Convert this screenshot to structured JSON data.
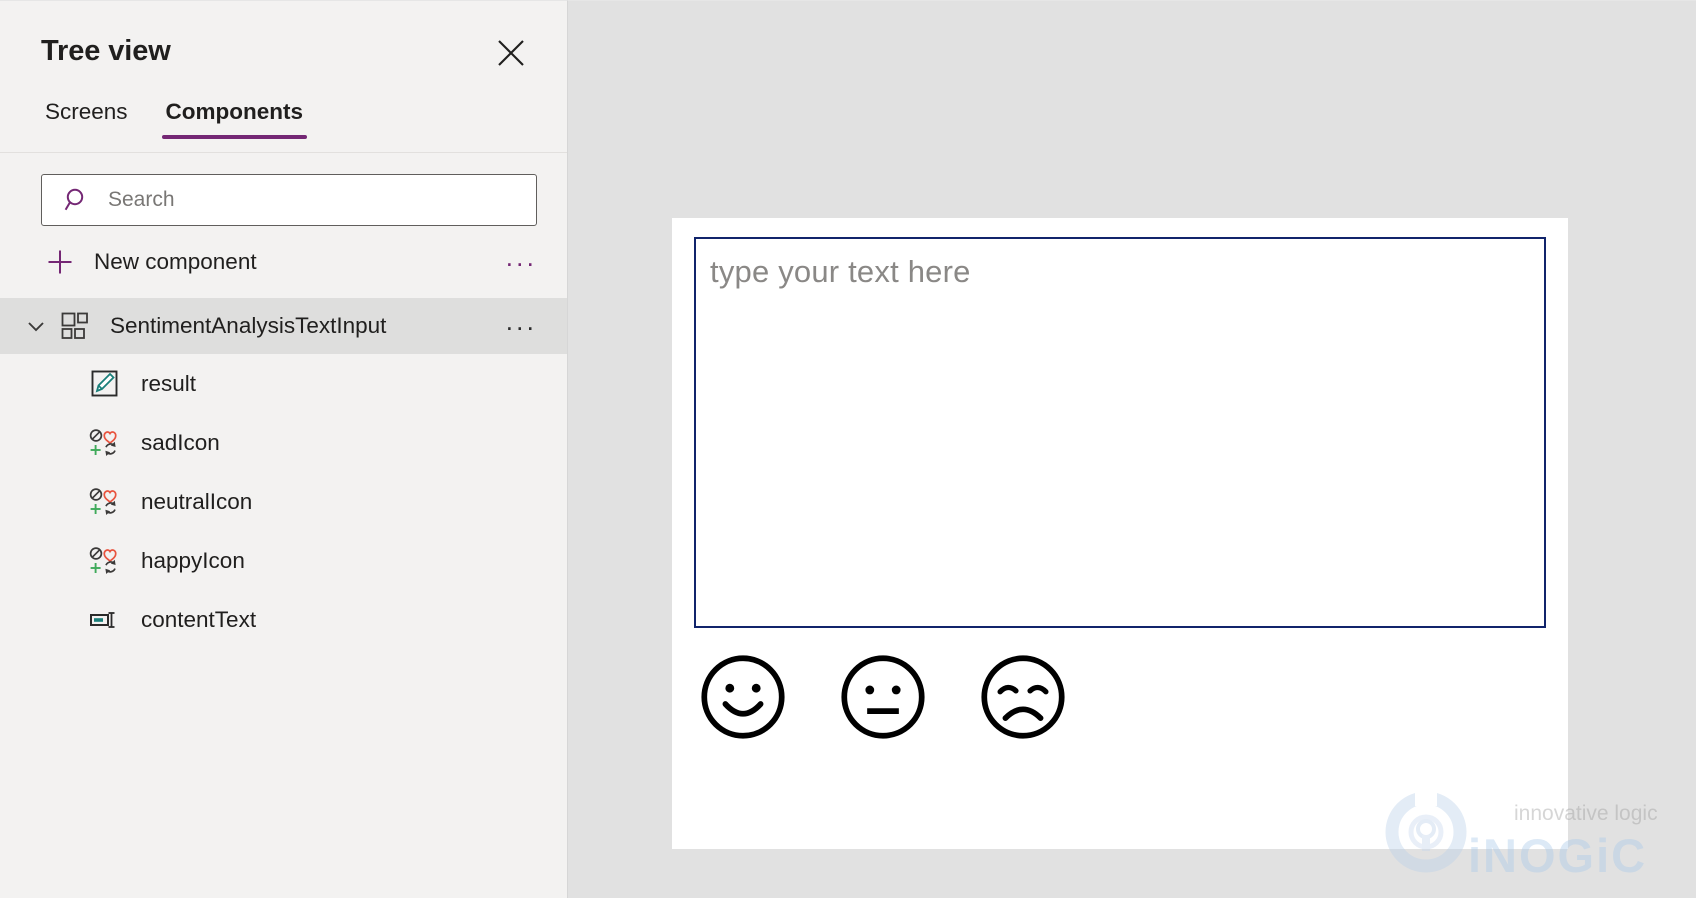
{
  "panel": {
    "title": "Tree view",
    "close_icon": "close-icon",
    "tabs": [
      {
        "label": "Screens",
        "active": false
      },
      {
        "label": "Components",
        "active": true
      }
    ],
    "active_tab_underline_color": "#742774",
    "search": {
      "placeholder": "Search",
      "value": "",
      "icon": "search-icon",
      "icon_color": "#742774"
    },
    "new_component": {
      "label": "New component",
      "icon": "plus-icon",
      "icon_color": "#742774",
      "overflow": "..."
    },
    "tree": {
      "root": {
        "label": "SentimentAnalysisTextInput",
        "icon": "component-icon",
        "expanded": true,
        "chevron": "chevron-down-icon",
        "selected": true,
        "overflow": "...",
        "children": [
          {
            "label": "result",
            "icon": "edit-pen-icon"
          },
          {
            "label": "sadIcon",
            "icon": "icon-control-icon"
          },
          {
            "label": "neutralIcon",
            "icon": "icon-control-icon"
          },
          {
            "label": "happyIcon",
            "icon": "icon-control-icon"
          },
          {
            "label": "contentText",
            "icon": "text-input-control-icon"
          }
        ]
      }
    }
  },
  "canvas": {
    "background_color": "#e1e1e1",
    "app": {
      "background_color": "#ffffff",
      "text_input": {
        "placeholder": "type your text here",
        "value": "",
        "border_color": "#11246b"
      },
      "faces": [
        {
          "name": "happy-face",
          "mood": "happy"
        },
        {
          "name": "neutral-face",
          "mood": "neutral"
        },
        {
          "name": "sad-face",
          "mood": "sad"
        }
      ]
    },
    "watermark": {
      "tagline": "innovative logic",
      "brand": "iNOGiC",
      "color": "#9dc3e6"
    }
  }
}
